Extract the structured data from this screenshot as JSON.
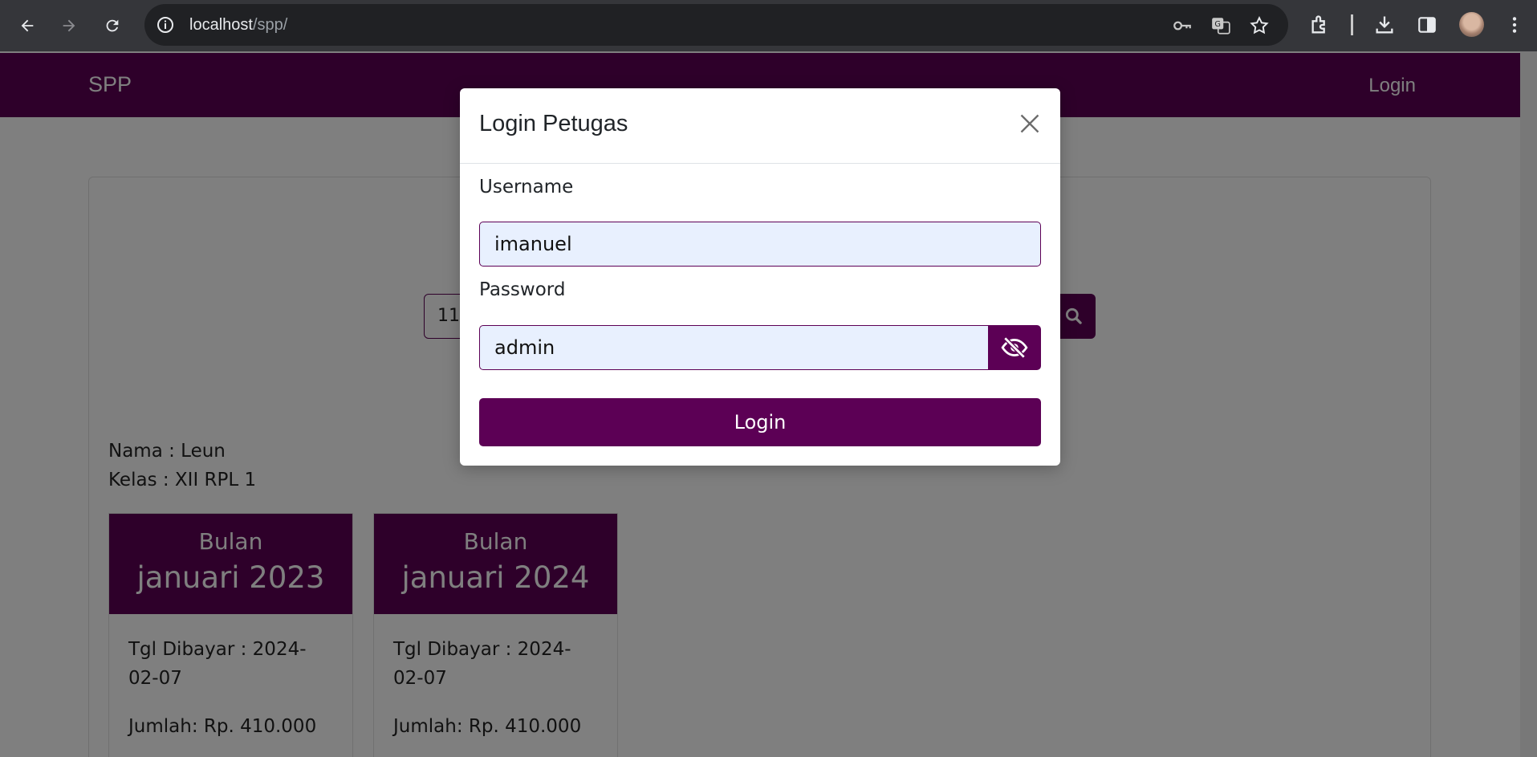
{
  "browser": {
    "url_host": "localhost",
    "url_path": "/spp/"
  },
  "navbar": {
    "brand": "SPP",
    "login_link": "Login"
  },
  "search": {
    "value": "110"
  },
  "student": {
    "name_line": "Nama : Leun",
    "class_line": "Kelas : XII RPL 1"
  },
  "payments": [
    {
      "label": "Bulan",
      "month": "januari 2023",
      "date_line": "Tgl Dibayar : 2024-02-07",
      "amount_line": "Jumlah: Rp. 410.000"
    },
    {
      "label": "Bulan",
      "month": "januari 2024",
      "date_line": "Tgl Dibayar : 2024-02-07",
      "amount_line": "Jumlah: Rp. 410.000"
    }
  ],
  "modal": {
    "title": "Login Petugas",
    "username_label": "Username",
    "username_value": "imanuel",
    "password_label": "Password",
    "password_value": "admin",
    "submit_label": "Login"
  },
  "colors": {
    "brand_purple": "#5c0055",
    "autofill_blue": "#e8f0fe"
  }
}
